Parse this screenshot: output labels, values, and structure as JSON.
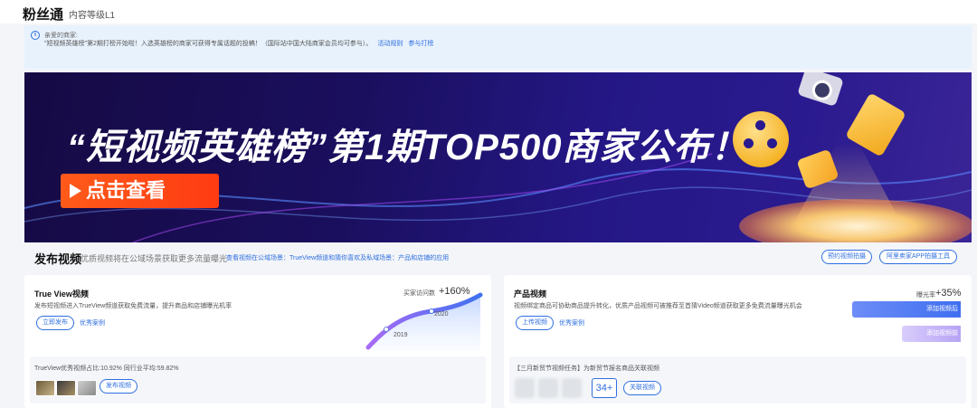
{
  "header": {
    "brand": "粉丝通",
    "level": "内容等级L1"
  },
  "notice": {
    "line1": "亲爱的商家:",
    "line2": "\"短视频英雄榜\"第2期打榜开始啦！入选英雄榜的商家可获得专属话题的投稿！（国际站中国大陆商家会员均可参与）。",
    "link_rules": "活动规则",
    "link_join": "参与打榜"
  },
  "banner": {
    "title": "“短视频英雄榜”第1期TOP500商家公布！",
    "cta": "点击查看"
  },
  "section": {
    "title": "发布视频",
    "desc": "优质视频将在公域场景获取更多流量曝光",
    "link": "查看视频在公域场景：TrueView频道和猜你喜欢及私域场景：产品和店铺的应用",
    "btn_book": "预约视频拍摄",
    "btn_app": "阿里卖家APP拍摄工具"
  },
  "card_trueview": {
    "title": "True View视频",
    "desc": "发布短视频进入TrueView频道获取免费流量，提升商品和店铺曝光机率",
    "btn_publish": "立即发布",
    "link_cases": "优秀案例",
    "metric_label": "买家访问数",
    "metric_value": "+160%",
    "year_start": "2019",
    "year_end": "2020",
    "stats": "TrueView优秀视频占比:10.92% 同行业平均:59.82%",
    "btn_publish_video": "发布视频"
  },
  "card_product": {
    "title": "产品视频",
    "desc": "视频绑定商品可协助商品提升转化，优质产品视频可被推荐至首猜Video频道获取更多免费流量曝光机会",
    "btn_upload": "上传视频",
    "link_cases": "优秀案例",
    "metric_label": "曝光率",
    "metric_value": "+35%",
    "bar_primary": "添加视频后",
    "bar_secondary": "添加视频前",
    "task": "【三月新贸节视频任务】为新贸节报名商品关联视频",
    "count": "34+",
    "btn_link": "关联视频"
  }
}
